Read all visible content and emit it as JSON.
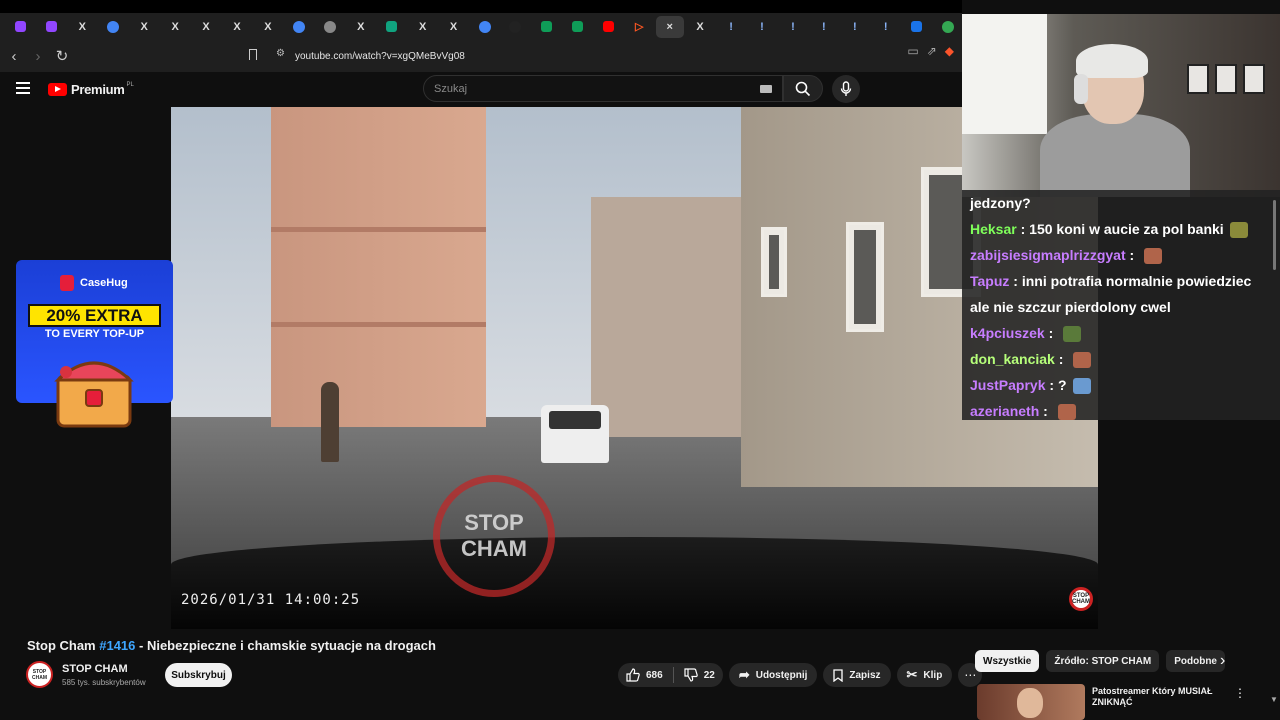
{
  "browser": {
    "tabs": [
      {
        "icon": "twitch-icon",
        "glyph": "",
        "color": "#9146ff",
        "kind": "sq"
      },
      {
        "icon": "twitch-icon",
        "glyph": "",
        "color": "#9146ff",
        "kind": "sq"
      },
      {
        "icon": "x-icon",
        "glyph": "X",
        "color": "",
        "kind": "txt"
      },
      {
        "icon": "google-icon",
        "glyph": "",
        "color": "#4285f4",
        "kind": "ci"
      },
      {
        "icon": "x-icon",
        "glyph": "X",
        "color": "",
        "kind": "txt"
      },
      {
        "icon": "x-icon",
        "glyph": "X",
        "color": "",
        "kind": "txt"
      },
      {
        "icon": "x-icon",
        "glyph": "X",
        "color": "",
        "kind": "txt"
      },
      {
        "icon": "x-icon",
        "glyph": "X",
        "color": "",
        "kind": "txt"
      },
      {
        "icon": "x-icon",
        "glyph": "X",
        "color": "",
        "kind": "txt"
      },
      {
        "icon": "google-icon",
        "glyph": "",
        "color": "#4285f4",
        "kind": "ci"
      },
      {
        "icon": "globe-icon",
        "glyph": "",
        "color": "#888888",
        "kind": "ci"
      },
      {
        "icon": "x-icon",
        "glyph": "X",
        "color": "",
        "kind": "txt"
      },
      {
        "icon": "chatgpt-icon",
        "glyph": "",
        "color": "#10a37f",
        "kind": "sq"
      },
      {
        "icon": "x-icon",
        "glyph": "X",
        "color": "",
        "kind": "txt"
      },
      {
        "icon": "x-icon",
        "glyph": "X",
        "color": "",
        "kind": "txt"
      },
      {
        "icon": "google-icon",
        "glyph": "",
        "color": "#4285f4",
        "kind": "ci"
      },
      {
        "icon": "tiktok-icon",
        "glyph": "",
        "color": "#222222",
        "kind": "ci"
      },
      {
        "icon": "sheets-icon",
        "glyph": "",
        "color": "#0f9d58",
        "kind": "sq"
      },
      {
        "icon": "sheets-icon",
        "glyph": "",
        "color": "#0f9d58",
        "kind": "sq"
      },
      {
        "icon": "youtube-icon",
        "glyph": "",
        "color": "#ff0000",
        "kind": "sq"
      },
      {
        "icon": "play-icon",
        "glyph": "▷",
        "color": "#ff5722",
        "kind": "txt"
      },
      {
        "icon": "close-icon",
        "glyph": "×",
        "color": "",
        "kind": "active"
      },
      {
        "icon": "x-icon",
        "glyph": "X",
        "color": "",
        "kind": "txt"
      },
      {
        "icon": "exclamation-icon",
        "glyph": "!",
        "color": "#8ab4f8",
        "kind": "txt"
      },
      {
        "icon": "exclamation-icon",
        "glyph": "!",
        "color": "#8ab4f8",
        "kind": "txt"
      },
      {
        "icon": "exclamation-icon",
        "glyph": "!",
        "color": "#8ab4f8",
        "kind": "txt"
      },
      {
        "icon": "exclamation-icon",
        "glyph": "!",
        "color": "#8ab4f8",
        "kind": "txt"
      },
      {
        "icon": "exclamation-icon",
        "glyph": "!",
        "color": "#8ab4f8",
        "kind": "txt"
      },
      {
        "icon": "exclamation-icon",
        "glyph": "!",
        "color": "#8ab4f8",
        "kind": "txt"
      },
      {
        "icon": "calendar-icon",
        "glyph": "",
        "color": "#1a73e8",
        "kind": "sq"
      },
      {
        "icon": "maps-icon",
        "glyph": "",
        "color": "#34a853",
        "kind": "ci"
      }
    ],
    "url": "youtube.com/watch?v=xgQMeBvVg08"
  },
  "youtube": {
    "brand": "Premium",
    "country": "PL",
    "search_placeholder": "Szukaj"
  },
  "video": {
    "timestamp": "2026/01/31  14:00:25",
    "stamp_line1": "STOP",
    "stamp_line2": "CHAM",
    "watermark": "STOP CHAM",
    "title_prefix": "Stop Cham ",
    "title_tag": "#1416",
    "title_suffix": " - Niebezpieczne i chamskie sytuacje na drogach"
  },
  "ad": {
    "brand": "CaseHug",
    "headline": "20% EXTRA",
    "sub": "TO EVERY TOP-UP"
  },
  "chat": {
    "top_fragment": "jedzony?",
    "messages": [
      {
        "nick": "Heksar",
        "nick_color": "#7fff5a",
        "text": "150 koni w aucie za pol banki",
        "emote_color": "#8a8a3a"
      },
      {
        "nick": "zabijsiesigmaplrizzgyat",
        "nick_color": "#c77dff",
        "text": "",
        "emote_color": "#b0644a"
      },
      {
        "nick": "Tapuz",
        "nick_color": "#c77dff",
        "text": "inni potrafia normalnie powiedziec ale nie szczur pierdolony cwel",
        "emote_color": ""
      },
      {
        "nick": "k4pciuszek",
        "nick_color": "#c77dff",
        "text": "",
        "emote_color": "#5a7a3a"
      },
      {
        "nick": "don_kanciak",
        "nick_color": "#b6ff7a",
        "text": "",
        "emote_color": "#b0644a"
      },
      {
        "nick": "JustPapryk",
        "nick_color": "#c77dff",
        "text": "?",
        "emote_color": "#6a9ad0"
      },
      {
        "nick": "azerianeth",
        "nick_color": "#c77dff",
        "text": "",
        "emote_color": "#b0644a"
      }
    ]
  },
  "channel": {
    "name": "STOP CHAM",
    "subs": "585 tys. subskrybentów",
    "avatar_text": "STOP CHAM",
    "subscribe": "Subskrybuj"
  },
  "actions": {
    "likes": "686",
    "dislikes": "22",
    "share": "Udostępnij",
    "save": "Zapisz",
    "clip": "Klip"
  },
  "chips": [
    "Wszystkie",
    "Źródło: STOP CHAM",
    "Podobne"
  ],
  "recommendation": {
    "title": "Patostreamer Który MUSIAŁ ZNIKNĄĆ"
  }
}
